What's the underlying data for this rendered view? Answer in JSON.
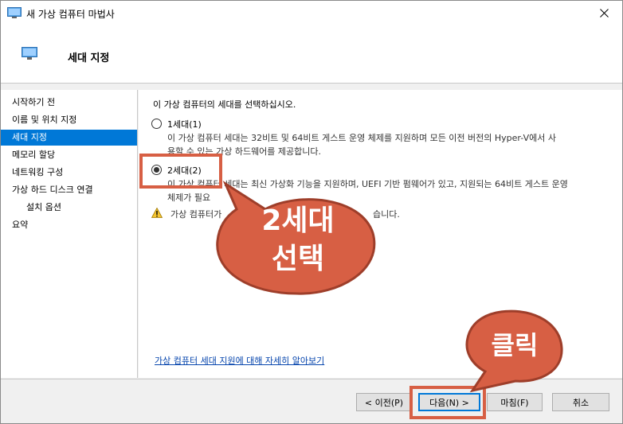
{
  "window": {
    "title": "새 가상 컴퓨터 마법사",
    "header_title": "세대 지정"
  },
  "nav": {
    "items": [
      {
        "label": "시작하기 전",
        "active": false
      },
      {
        "label": "이름 및 위치 지정",
        "active": false
      },
      {
        "label": "세대 지정",
        "active": true
      },
      {
        "label": "메모리 할당",
        "active": false
      },
      {
        "label": "네트워킹 구성",
        "active": false
      },
      {
        "label": "가상 하드 디스크 연결",
        "active": false
      },
      {
        "label": "설치 옵션",
        "active": false
      },
      {
        "label": "요약",
        "active": false
      }
    ]
  },
  "content": {
    "intro": "이 가상 컴퓨터의 세대를 선택하십시오.",
    "gen1": {
      "label": "1세대(1)",
      "desc_line1": "이 가상 컴퓨터 세대는 32비트 및 64비트 게스트 운영 체제를 지원하며 모든 이전 버전의 Hyper-V에서 사",
      "desc_line2": "용할 수 있는 가상 하드웨어를 제공합니다.",
      "checked": false
    },
    "gen2": {
      "label": "2세대(2)",
      "desc_line1": "이 가상 컴퓨터 세대는 최신 가상화 기능을 지원하며, UEFI 기반 펌웨어가 있고, 지원되는 64비트 게스트 운영",
      "desc_line2": "체제가 필요",
      "checked": true
    },
    "warning": "가상 컴퓨터가",
    "warning_tail": "습니다.",
    "help_link": "가상 컴퓨터 세대 지원에 대해 자세히 알아보기"
  },
  "buttons": {
    "prev": "< 이전(P)",
    "next": "다음(N) >",
    "finish": "마침(F)",
    "cancel": "취소"
  },
  "annotations": {
    "callout1_line1": "2세대",
    "callout1_line2": "선택",
    "callout2": "클릭",
    "accent_color": "#d75f44"
  }
}
